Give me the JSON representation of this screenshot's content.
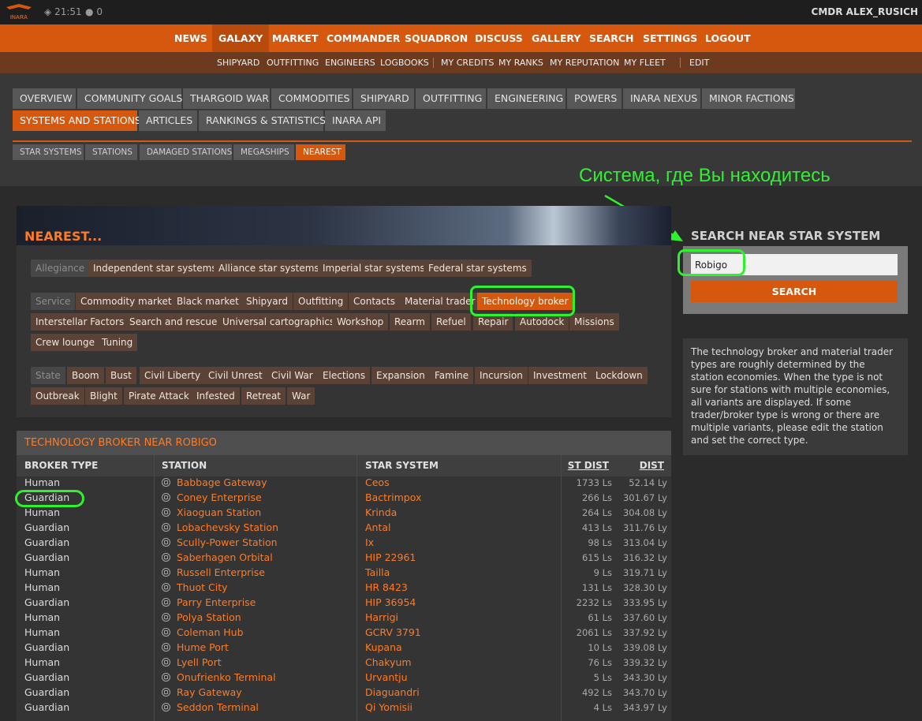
{
  "topbar": {
    "logo_text": "INARA",
    "time": "21:51",
    "count": "0",
    "cmdr": "CMDR ALEX_RUSICH"
  },
  "mainnav": [
    "NEWS",
    "GALAXY",
    "MARKET",
    "COMMANDER",
    "SQUADRON",
    "DISCUSS",
    "GALLERY",
    "SEARCH",
    "SETTINGS",
    "LOGOUT"
  ],
  "subnav": [
    "SHIPYARD",
    "OUTFITTING",
    "ENGINEERS",
    "LOGBOOKS",
    "MY CREDITS",
    "MY RANKS",
    "MY REPUTATION",
    "MY FLEET",
    "EDIT"
  ],
  "tabs_row1": [
    "OVERVIEW",
    "COMMUNITY GOALS",
    "THARGOID WAR",
    "COMMODITIES",
    "SHIPYARD",
    "OUTFITTING",
    "ENGINEERING",
    "POWERS",
    "INARA NEXUS",
    "MINOR FACTIONS"
  ],
  "tabs_row2": [
    "SYSTEMS AND STATIONS",
    "ARTICLES",
    "RANKINGS & STATISTICS",
    "INARA API"
  ],
  "subtabs": [
    "STAR SYSTEMS",
    "STATIONS",
    "DAMAGED STATIONS",
    "MEGASHIPS",
    "NEAREST"
  ],
  "annotation": "Система, где Вы находитесь",
  "nearest": {
    "title": "NEAREST...",
    "allegiance_label": "Allegiance",
    "allegiance": [
      "Independent star systems",
      "Alliance star systems",
      "Imperial star systems",
      "Federal star systems"
    ],
    "service_label": "Service",
    "services": [
      "Commodity market",
      "Black market",
      "Shipyard",
      "Outfitting",
      "Contacts",
      "Material trader",
      "Technology broker",
      "Interstellar Factors",
      "Search and rescue",
      "Universal cartographics",
      "Workshop",
      "Rearm",
      "Refuel",
      "Repair",
      "Autodock",
      "Missions",
      "Crew lounge",
      "Tuning"
    ],
    "state_label": "State",
    "states": [
      "Boom",
      "Bust",
      "Civil Liberty",
      "Civil Unrest",
      "Civil War",
      "Elections",
      "Expansion",
      "Famine",
      "Incursion",
      "Investment",
      "Lockdown",
      "Outbreak",
      "Blight",
      "Pirate Attack",
      "Infested",
      "Retreat",
      "War"
    ]
  },
  "search": {
    "title": "SEARCH NEAR STAR SYSTEM",
    "value": "Robigo",
    "button": "SEARCH"
  },
  "info_text": "The technology broker and material trader types are roughly determined by the station economies. When the type is not sure for stations with multiple economies, all variants are displayed. If some trader/broker type is wrong or there are multiple variants, please edit the station and set the correct type.",
  "results": {
    "title": "TECHNOLOGY BROKER NEAR ROBIGO",
    "columns": [
      "BROKER TYPE",
      "STATION",
      "STAR SYSTEM",
      "ST DIST",
      "DIST"
    ],
    "rows": [
      [
        "Human",
        "Babbage Gateway",
        "Ceos",
        "1733 Ls",
        "52.14 Ly"
      ],
      [
        "Guardian",
        "Coney Enterprise",
        "Bactrimpox",
        "266 Ls",
        "301.67 Ly"
      ],
      [
        "Human",
        "Xiaoguan Station",
        "Krinda",
        "264 Ls",
        "304.08 Ly"
      ],
      [
        "Guardian",
        "Lobachevsky Station",
        "Antal",
        "413 Ls",
        "311.76 Ly"
      ],
      [
        "Guardian",
        "Scully-Power Station",
        "Ix",
        "98 Ls",
        "313.04 Ly"
      ],
      [
        "Guardian",
        "Saberhagen Orbital",
        "HIP 22961",
        "615 Ls",
        "316.32 Ly"
      ],
      [
        "Human",
        "Russell Enterprise",
        "Tailla",
        "9 Ls",
        "319.71 Ly"
      ],
      [
        "Human",
        "Thuot City",
        "HR 8423",
        "131 Ls",
        "328.30 Ly"
      ],
      [
        "Guardian",
        "Parry Enterprise",
        "HIP 36954",
        "2232 Ls",
        "333.95 Ly"
      ],
      [
        "Human",
        "Polya Station",
        "Harrigi",
        "61 Ls",
        "337.60 Ly"
      ],
      [
        "Human",
        "Coleman Hub",
        "GCRV 3791",
        "2061 Ls",
        "337.92 Ly"
      ],
      [
        "Guardian",
        "Hume Port",
        "Kupana",
        "10 Ls",
        "339.08 Ly"
      ],
      [
        "Human",
        "Lyell Port",
        "Chakyum",
        "76 Ls",
        "339.32 Ly"
      ],
      [
        "Guardian",
        "Onufrienko Terminal",
        "Urvantju",
        "5 Ls",
        "343.30 Ly"
      ],
      [
        "Guardian",
        "Ray Gateway",
        "Diaguandri",
        "492 Ls",
        "343.70 Ly"
      ],
      [
        "Guardian",
        "Seddon Terminal",
        "Qi Yomisii",
        "4 Ls",
        "343.97 Ly"
      ]
    ]
  }
}
